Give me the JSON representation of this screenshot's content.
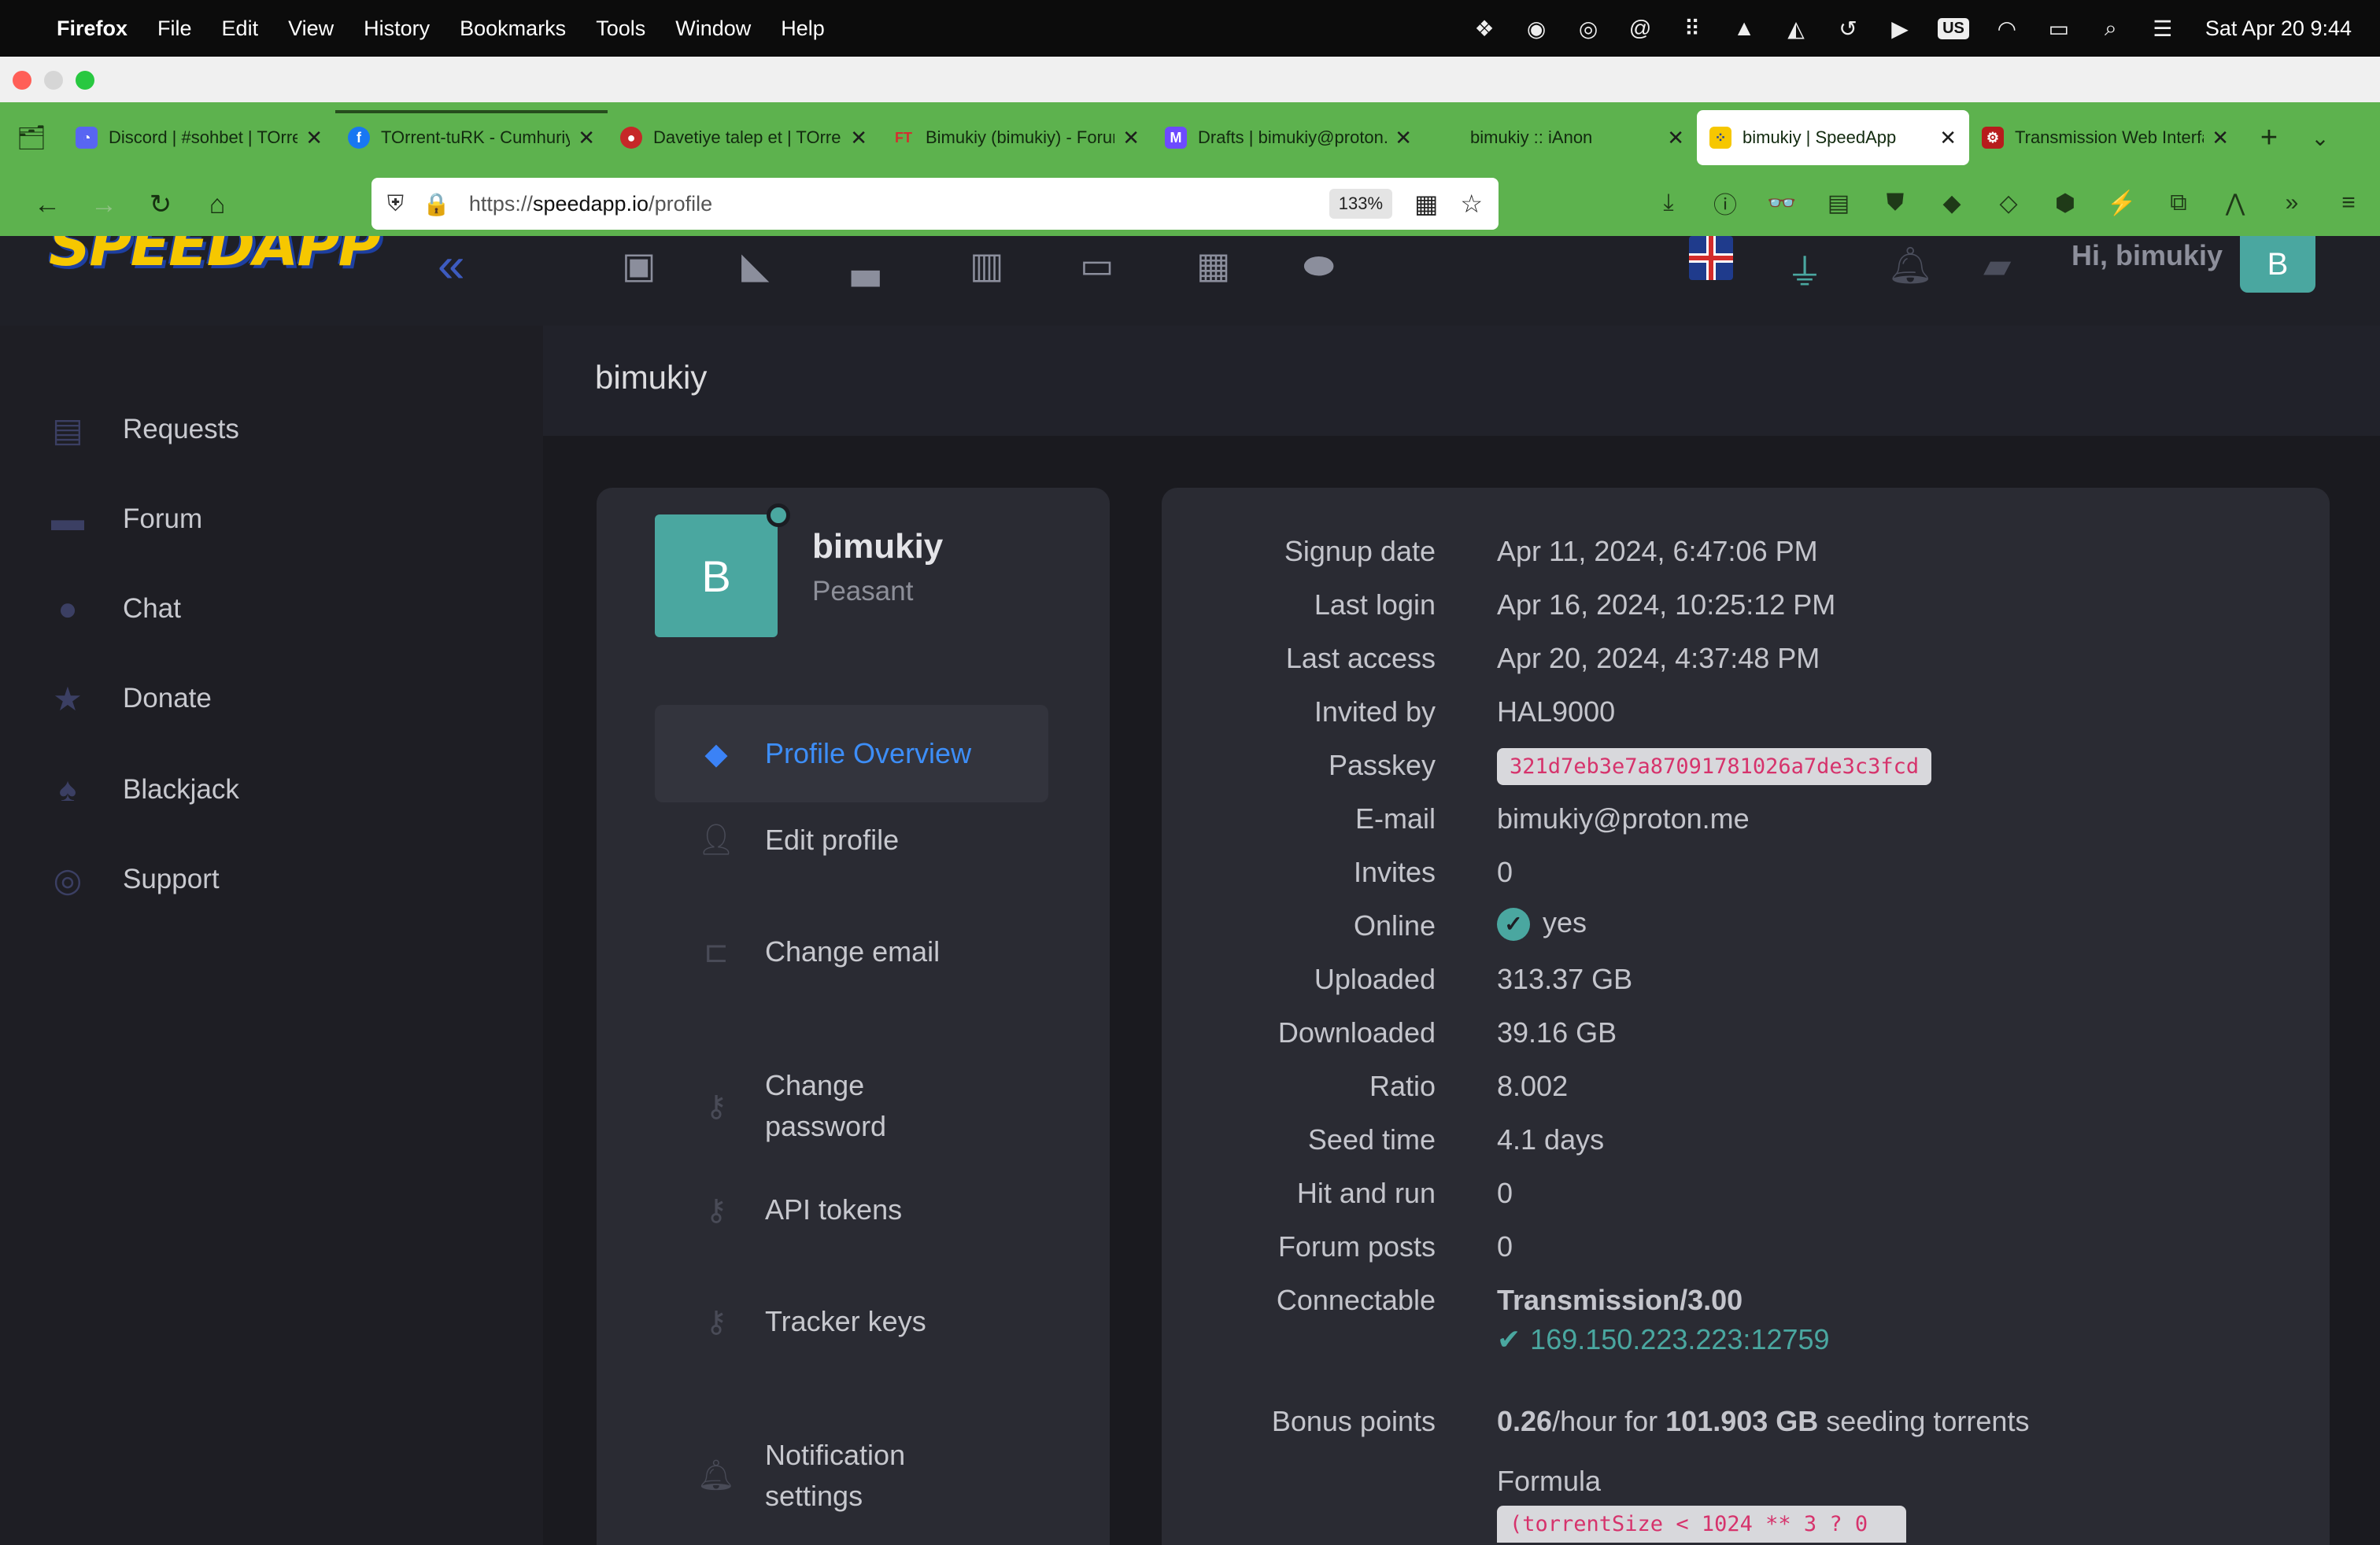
{
  "menubar": {
    "app": "Firefox",
    "items": [
      "File",
      "Edit",
      "View",
      "History",
      "Bookmarks",
      "Tools",
      "Window",
      "Help"
    ],
    "keyboard": "US",
    "clock": "Sat Apr 20  9:44"
  },
  "tabs": [
    {
      "title": "Discord | #sohbet | TOrrent-tuRK",
      "favicon_color": "#5865f2",
      "favicon": "discord-icon"
    },
    {
      "title": "TOrrent-tuRK - Cumhuriyet",
      "favicon_color": "#1877f2",
      "favicon": "facebook-icon"
    },
    {
      "title": "Davetiye talep et | TOrrent-tuRK",
      "favicon_color": "#c62828",
      "favicon": "toruk-icon"
    },
    {
      "title": "Bimukiy (bimukiy) - Forum",
      "favicon_color": "#d32f2f",
      "favicon": "ft-icon"
    },
    {
      "title": "Drafts | bimukiy@proton.me",
      "favicon_color": "#6d4aff",
      "favicon": "proton-mail-icon"
    },
    {
      "title": "bimukiy :: iAnon",
      "favicon_color": "#8a8a8a",
      "favicon": "apple-icon"
    },
    {
      "title": "bimukiy | SpeedApp",
      "favicon_color": "#f6c700",
      "favicon": "speedapp-icon",
      "active": true
    },
    {
      "title": "Transmission Web Interface",
      "favicon_color": "#b71c1c",
      "favicon": "transmission-icon"
    }
  ],
  "urlbar": {
    "scheme": "https://",
    "host": "speedapp.io",
    "path": "/profile",
    "zoom": "133%"
  },
  "header": {
    "greeting": "Hi, bimukiy",
    "avatar_initial": "B"
  },
  "sidebar": {
    "items": [
      {
        "label": "Requests",
        "icon": "inbox-icon"
      },
      {
        "label": "Forum",
        "icon": "forum-icon"
      },
      {
        "label": "Chat",
        "icon": "chat-icon"
      },
      {
        "label": "Donate",
        "icon": "star-icon"
      },
      {
        "label": "Blackjack",
        "icon": "blackjack-icon"
      },
      {
        "label": "Support",
        "icon": "support-icon"
      }
    ]
  },
  "page": {
    "title": "bimukiy"
  },
  "profile": {
    "initial": "B",
    "username": "bimukiy",
    "rank": "Peasant",
    "menu": [
      {
        "label": "Profile Overview",
        "icon": "diamond-icon",
        "active": true
      },
      {
        "label": "Edit profile",
        "icon": "user-icon"
      },
      {
        "label": "Change email",
        "icon": "mailbox-icon"
      },
      {
        "label": "Change password",
        "icon": "key-icon"
      },
      {
        "label": "API tokens",
        "icon": "key-icon"
      },
      {
        "label": "Tracker keys",
        "icon": "key-icon"
      },
      {
        "label": "Notification settings",
        "icon": "bell-icon"
      }
    ]
  },
  "details": {
    "signup_label": "Signup date",
    "signup": "Apr 11, 2024, 6:47:06 PM",
    "lastlogin_label": "Last login",
    "lastlogin": "Apr 16, 2024, 10:25:12 PM",
    "lastaccess_label": "Last access",
    "lastaccess": "Apr 20, 2024, 4:37:48 PM",
    "invitedby_label": "Invited by",
    "invitedby": "HAL9000",
    "passkey_label": "Passkey",
    "passkey": "321d7eb3e7a87091781026a7de3c3fcd",
    "email_label": "E-mail",
    "email": "bimukiy@proton.me",
    "invites_label": "Invites",
    "invites": "0",
    "online_label": "Online",
    "online": "yes",
    "uploaded_label": "Uploaded",
    "uploaded": "313.37 GB",
    "downloaded_label": "Downloaded",
    "downloaded": "39.16 GB",
    "ratio_label": "Ratio",
    "ratio": "8.002",
    "seedtime_label": "Seed time",
    "seedtime": "4.1 days",
    "hitrun_label": "Hit and run",
    "hitrun": "0",
    "forumposts_label": "Forum posts",
    "forumposts": "0",
    "connectable_label": "Connectable",
    "client": "Transmission/3.00",
    "ip": "169.150.223.223:12759",
    "bonus_label": "Bonus points",
    "bonus_rate": "0.26",
    "bonus_per": "/hour for ",
    "bonus_size": "101.903 GB",
    "bonus_suffix": " seeding torrents",
    "formula_label": "Formula",
    "formula": "(torrentSize < 1024 ** 3 ? 0"
  }
}
